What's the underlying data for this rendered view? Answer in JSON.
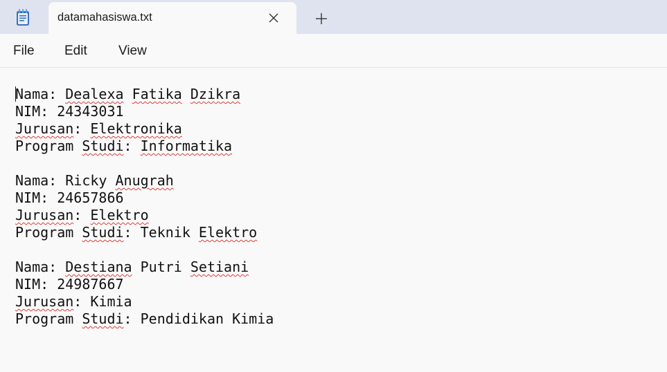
{
  "window": {
    "tab_title": "datamahasiswa.txt",
    "app_icon": "notepad-icon",
    "close_icon": "close-icon",
    "new_tab_icon": "plus-icon"
  },
  "menu": {
    "file": "File",
    "edit": "Edit",
    "view": "View"
  },
  "document": {
    "lines": [
      [
        {
          "t": "Nama: "
        },
        {
          "t": "Dealexa",
          "sq": true
        },
        {
          "t": " "
        },
        {
          "t": "Fatika",
          "sq": true
        },
        {
          "t": " "
        },
        {
          "t": "Dzikra",
          "sq": true
        }
      ],
      [
        {
          "t": "NIM: 24343031"
        }
      ],
      [
        {
          "t": "Jurusan",
          "sq": true
        },
        {
          "t": ": "
        },
        {
          "t": "Elektronika",
          "sq": true
        }
      ],
      [
        {
          "t": "Program "
        },
        {
          "t": "Studi",
          "sq": true
        },
        {
          "t": ": "
        },
        {
          "t": "Informatika",
          "sq": true
        }
      ],
      [
        {
          "t": ""
        }
      ],
      [
        {
          "t": "Nama: Ricky "
        },
        {
          "t": "Anugrah",
          "sq": true
        }
      ],
      [
        {
          "t": "NIM: 24657866"
        }
      ],
      [
        {
          "t": "Jurusan",
          "sq": true
        },
        {
          "t": ": "
        },
        {
          "t": "Elektro",
          "sq": true
        }
      ],
      [
        {
          "t": "Program "
        },
        {
          "t": "Studi",
          "sq": true
        },
        {
          "t": ": Teknik "
        },
        {
          "t": "Elektro",
          "sq": true
        }
      ],
      [
        {
          "t": ""
        }
      ],
      [
        {
          "t": "Nama: "
        },
        {
          "t": "Destiana",
          "sq": true
        },
        {
          "t": " Putri "
        },
        {
          "t": "Setiani",
          "sq": true
        }
      ],
      [
        {
          "t": "NIM: 24987667"
        }
      ],
      [
        {
          "t": "Jurusan",
          "sq": true
        },
        {
          "t": ": Kimia"
        }
      ],
      [
        {
          "t": "Program "
        },
        {
          "t": "Studi",
          "sq": true
        },
        {
          "t": ": Pendidikan Kimia"
        }
      ]
    ]
  },
  "colors": {
    "titlebar": "#dfe3ef",
    "background": "#f9f9f9",
    "spellcheck": "#e23a3a"
  }
}
